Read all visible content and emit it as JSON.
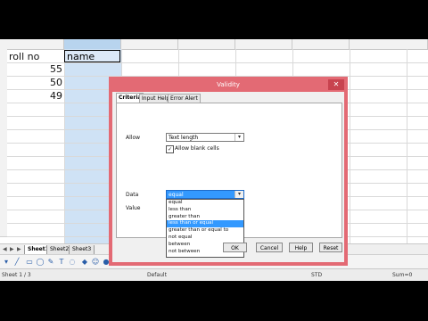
{
  "columns": [
    "",
    "",
    "",
    "",
    "",
    "",
    ""
  ],
  "rows": [
    "",
    "",
    "",
    "",
    "",
    "",
    "",
    "",
    "",
    "",
    "",
    "",
    "",
    ""
  ],
  "cells": {
    "a1": "roll no",
    "b1": "name",
    "a2": "55",
    "a3": "50",
    "a4": "49"
  },
  "sheet_tabs": [
    "Sheet1",
    "Sheet2",
    "Sheet3"
  ],
  "status": {
    "sheet": "Sheet 1 / 3",
    "style": "Default",
    "mode": "STD",
    "sum": "Sum=0"
  },
  "dialog": {
    "title": "Validity",
    "tabs": [
      "Criteria",
      "Input Help",
      "Error Alert"
    ],
    "allow_label": "Allow",
    "allow_value": "Text length",
    "allow_blank_label": "Allow blank cells",
    "allow_blank_checked": "✓",
    "data_label": "Data",
    "value_label": "Value",
    "data_value": "equal",
    "options": [
      "equal",
      "less than",
      "greater than",
      "less than or equal",
      "greater than or equal to",
      "not equal",
      "between",
      "not between"
    ],
    "highlighted_option": 3,
    "buttons": {
      "ok": "OK",
      "cancel": "Cancel",
      "help": "Help",
      "reset": "Reset"
    }
  },
  "colors": {
    "dialog_border": "#e36a74",
    "selection": "#3399ff",
    "column_highlight": "#cfe2f5"
  }
}
